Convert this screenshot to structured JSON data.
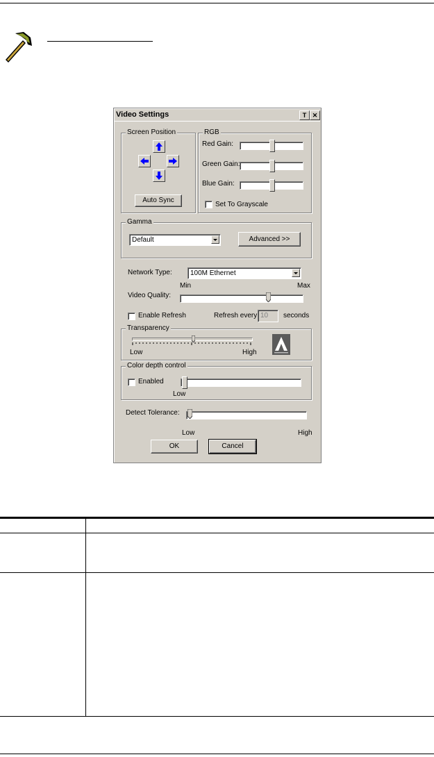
{
  "dialog": {
    "title": "Video Settings",
    "titlebar_help": "T",
    "titlebar_close": "✕",
    "screen_position": {
      "label": "Screen Position",
      "auto_sync": "Auto Sync"
    },
    "rgb": {
      "label": "RGB",
      "red_gain": "Red Gain:",
      "green_gain": "Green Gain:",
      "blue_gain": "Blue Gain:",
      "red_level": 0.5,
      "green_level": 0.5,
      "blue_level": 0.5,
      "grayscale": "Set To Grayscale"
    },
    "gamma": {
      "label": "Gamma",
      "value": "Default",
      "advanced": "Advanced >>"
    },
    "network": {
      "label": "Network Type:",
      "value": "100M Ethernet"
    },
    "video_quality": {
      "label": "Video Quality:",
      "min": "Min",
      "max": "Max",
      "level": 0.72
    },
    "refresh": {
      "enable": "Enable Refresh",
      "every": "Refresh every",
      "value": "10",
      "unit": "seconds"
    },
    "transparency": {
      "label": "Transparency",
      "low": "Low",
      "high": "High",
      "level": 0.5
    },
    "color_depth": {
      "label": "Color depth control",
      "enabled": "Enabled",
      "low": "Low",
      "level": 0.0
    },
    "detect_tolerance": {
      "label": "Detect Tolerance:",
      "low": "Low",
      "high": "High",
      "level": 0.0
    },
    "ok": "OK",
    "cancel": "Cancel"
  },
  "colors": {
    "dialog_bg": "#d4d0c8",
    "arrow_blue": "#0000ff",
    "logo_bg": "#5a5a5a"
  }
}
